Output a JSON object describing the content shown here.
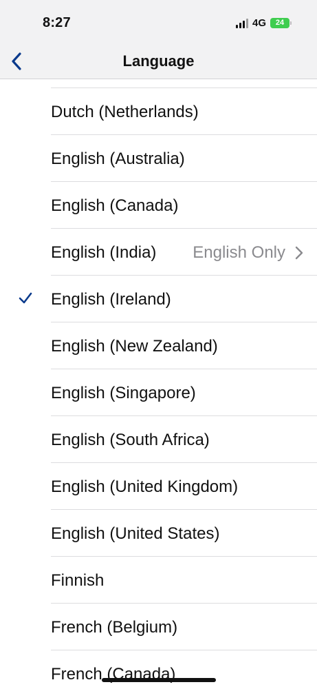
{
  "status_bar": {
    "time": "8:27",
    "network": "4G",
    "battery_level": "24"
  },
  "nav": {
    "title": "Language",
    "back_icon": "chevron-left-icon"
  },
  "colors": {
    "accent": "#0a3a8c",
    "battery": "#3fcd4f",
    "secondary_text": "#8a8a8e"
  },
  "languages": [
    {
      "label": "Dutch (Netherlands)",
      "selected": false,
      "detail": ""
    },
    {
      "label": "English (Australia)",
      "selected": false,
      "detail": ""
    },
    {
      "label": "English (Canada)",
      "selected": false,
      "detail": ""
    },
    {
      "label": "English (India)",
      "selected": false,
      "detail": "English Only"
    },
    {
      "label": "English (Ireland)",
      "selected": true,
      "detail": ""
    },
    {
      "label": "English (New Zealand)",
      "selected": false,
      "detail": ""
    },
    {
      "label": "English (Singapore)",
      "selected": false,
      "detail": ""
    },
    {
      "label": "English (South Africa)",
      "selected": false,
      "detail": ""
    },
    {
      "label": "English (United Kingdom)",
      "selected": false,
      "detail": ""
    },
    {
      "label": "English (United States)",
      "selected": false,
      "detail": ""
    },
    {
      "label": "Finnish",
      "selected": false,
      "detail": ""
    },
    {
      "label": "French (Belgium)",
      "selected": false,
      "detail": ""
    },
    {
      "label": "French (Canada)",
      "selected": false,
      "detail": ""
    }
  ]
}
